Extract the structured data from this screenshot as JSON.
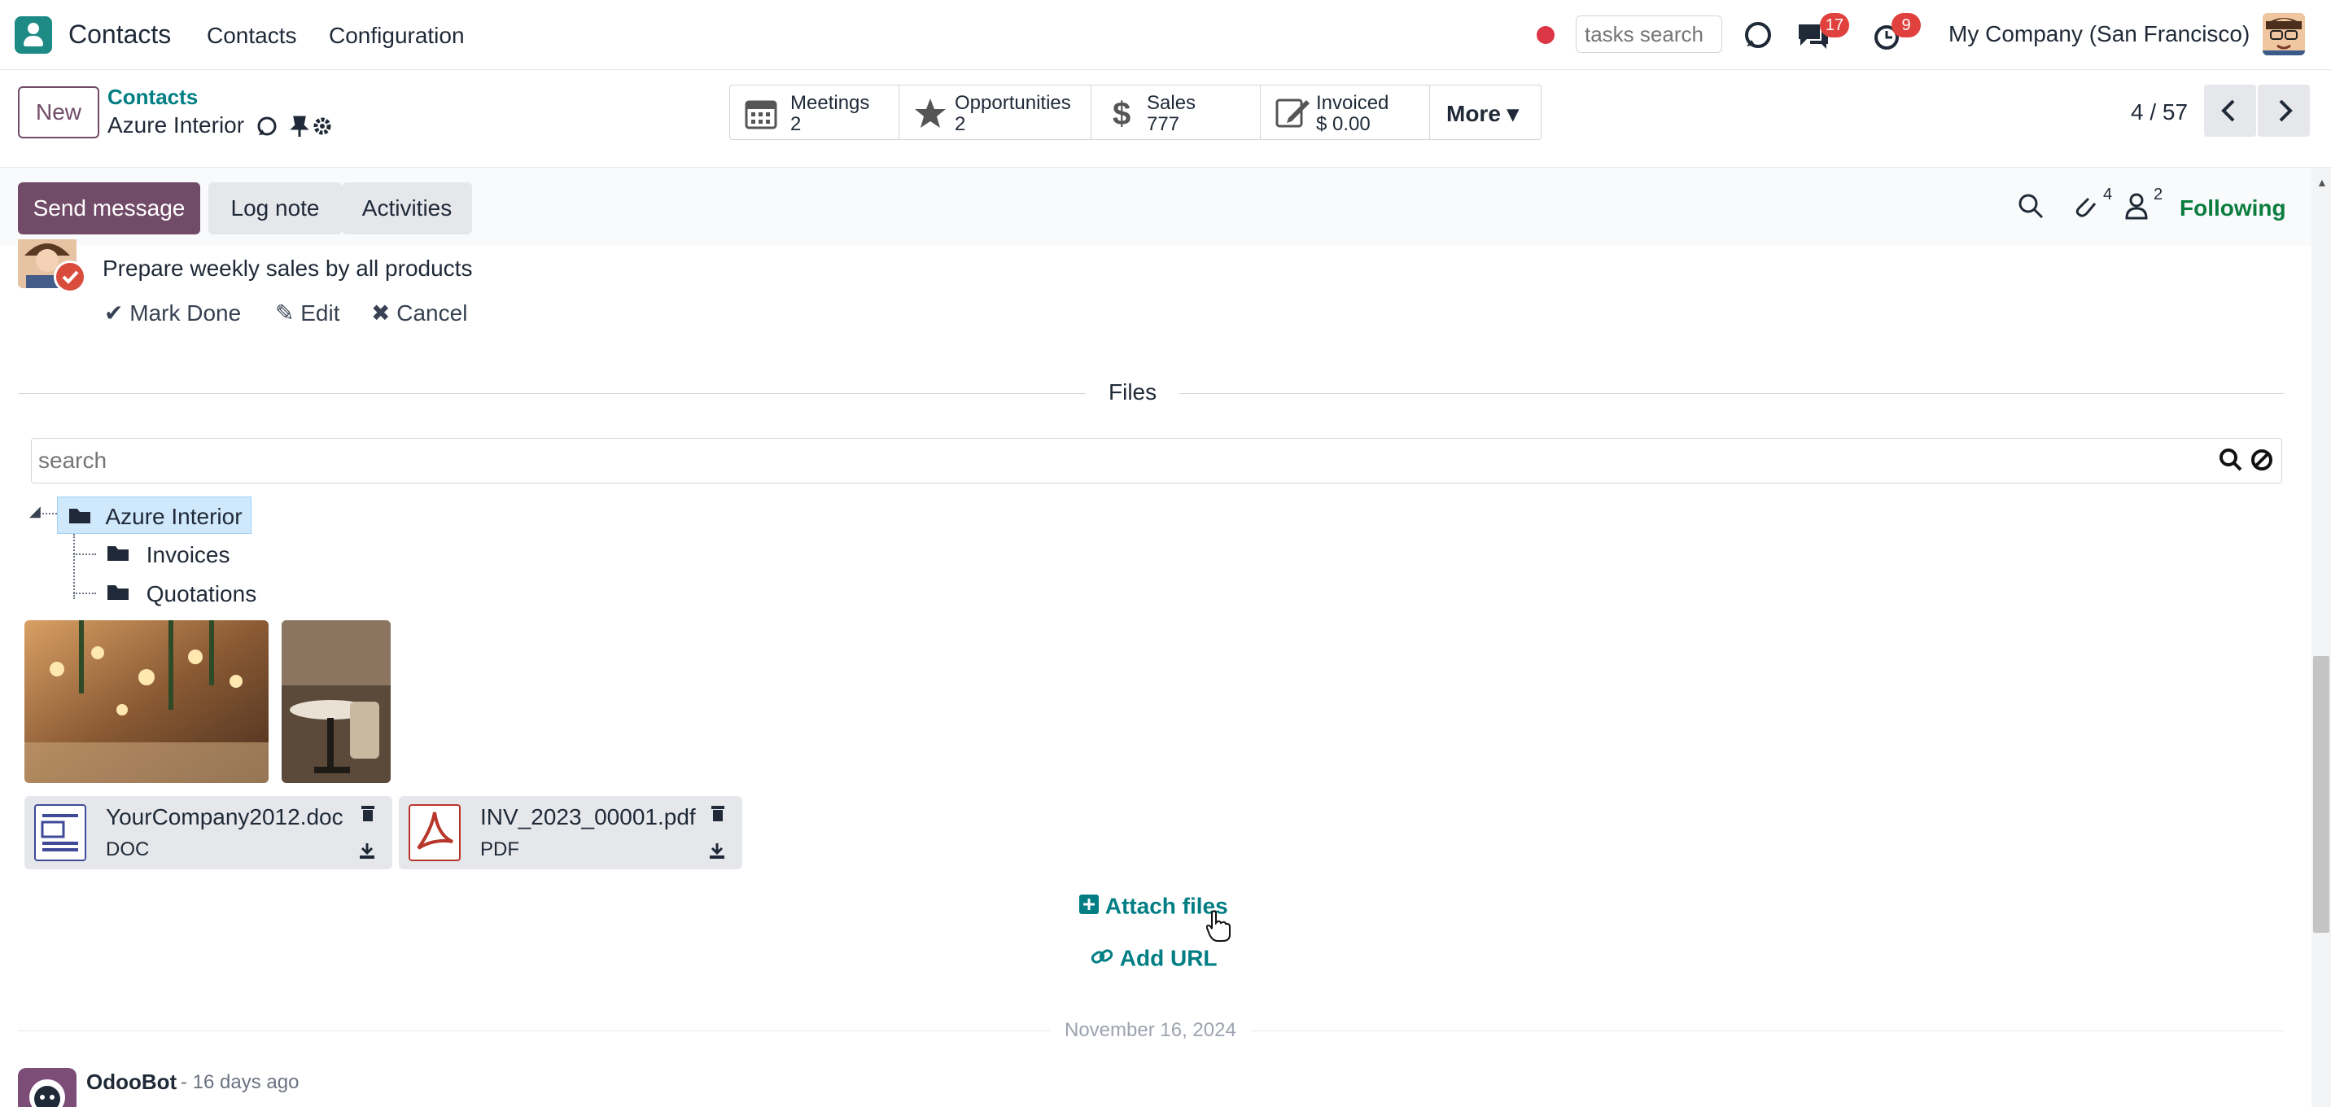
{
  "navbar": {
    "app_name": "Contacts",
    "menu": [
      "Contacts",
      "Configuration"
    ],
    "tasks_search_placeholder": "tasks search",
    "messages_badge": "17",
    "activities_badge": "9",
    "company": "My Company (San Francisco)"
  },
  "control": {
    "new_label": "New",
    "breadcrumb_parent": "Contacts",
    "breadcrumb_current": "Azure Interior",
    "stats": [
      {
        "label": "Meetings",
        "value": "2",
        "icon": "calendar-icon"
      },
      {
        "label": "Opportunities",
        "value": "2",
        "icon": "star-icon"
      },
      {
        "label": "Sales",
        "value": "777",
        "icon": "dollar-icon"
      },
      {
        "label": "Invoiced",
        "value": "$ 0.00",
        "icon": "invoice-icon"
      }
    ],
    "more_label": "More",
    "pager": "4 / 57"
  },
  "chatter": {
    "send_message": "Send message",
    "log_note": "Log note",
    "activities": "Activities",
    "attachments_count": "4",
    "followers_count": "2",
    "following": "Following",
    "activity": {
      "summary": "Prepare weekly sales by all products",
      "mark_done": "Mark Done",
      "edit": "Edit",
      "cancel": "Cancel"
    },
    "files_title": "Files",
    "files_search_placeholder": "search",
    "tree": {
      "root": "Azure Interior",
      "children": [
        "Invoices",
        "Quotations"
      ]
    },
    "files": [
      {
        "name": "YourCompany2012.doc",
        "type": "DOC",
        "icon": "doc-file-icon"
      },
      {
        "name": "INV_2023_00001.pdf",
        "type": "PDF",
        "icon": "pdf-file-icon"
      }
    ],
    "attach_files": "Attach files",
    "add_url": "Add URL",
    "date_separator": "November 16, 2024",
    "message": {
      "author": "OdooBot",
      "time": "- 16 days ago"
    }
  },
  "colors": {
    "primary": "#714b67",
    "link": "#017e84",
    "following": "#0a7d3f",
    "badge": "#e0413d"
  }
}
